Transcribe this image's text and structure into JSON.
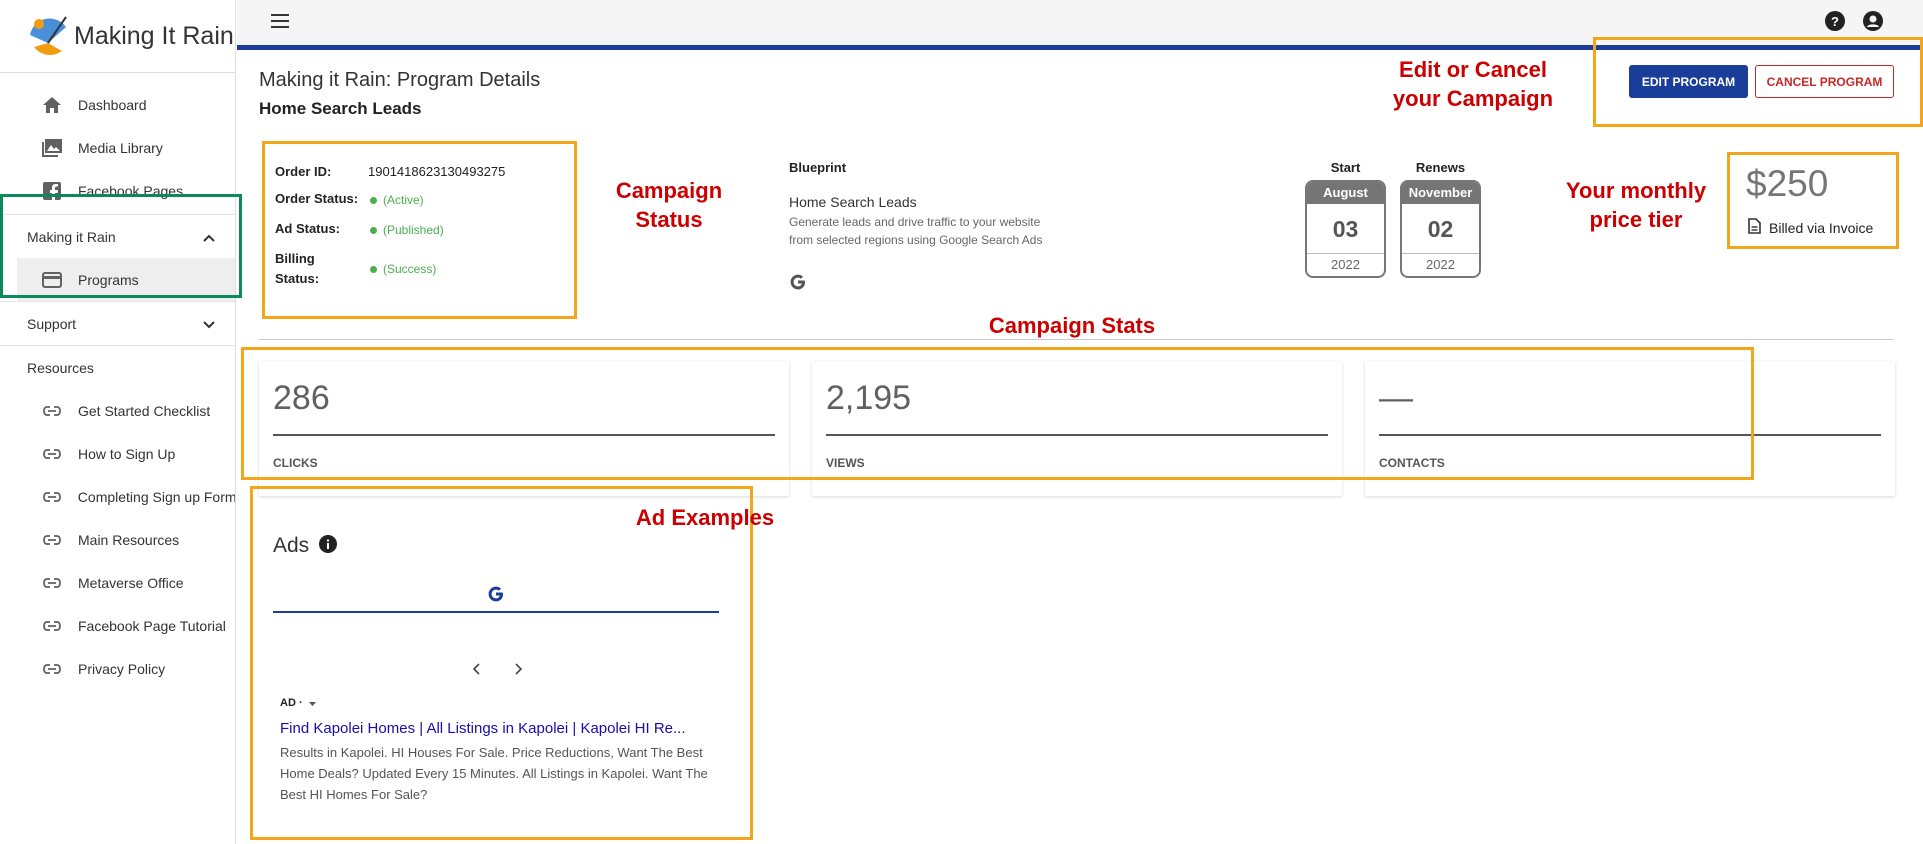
{
  "app": {
    "name": "Making It Rain"
  },
  "sidebar": {
    "items": [
      {
        "label": "Dashboard",
        "icon": "home-icon"
      },
      {
        "label": "Media Library",
        "icon": "image-icon"
      },
      {
        "label": "Facebook Pages",
        "icon": "facebook-icon"
      }
    ],
    "group_making": {
      "label": "Making it Rain",
      "child": "Programs"
    },
    "group_support": {
      "label": "Support"
    },
    "resources_label": "Resources",
    "resources": [
      "Get Started Checklist",
      "How to Sign Up",
      "Completing Sign up Form",
      "Main Resources",
      "Metaverse Office",
      "Facebook Page Tutorial",
      "Privacy Policy"
    ]
  },
  "page": {
    "title": "Making it Rain: Program Details",
    "subtitle": "Home Search Leads",
    "edit_label": "EDIT PROGRAM",
    "cancel_label": "CANCEL PROGRAM"
  },
  "order": {
    "id_label": "Order ID:",
    "id_value": "1901418623130493275",
    "status_label": "Order Status:",
    "status_value": "(Active)",
    "ad_label": "Ad Status:",
    "ad_value": "(Published)",
    "billing_label": "Billing Status:",
    "billing_value": "(Success)"
  },
  "blueprint": {
    "label": "Blueprint",
    "name": "Home Search Leads",
    "description": "Generate leads and drive traffic to your website from selected regions using Google Search Ads"
  },
  "dates": {
    "start_label": "Start",
    "start_month": "August",
    "start_day": "03",
    "start_year": "2022",
    "renew_label": "Renews",
    "renew_month": "November",
    "renew_day": "02",
    "renew_year": "2022"
  },
  "price": {
    "amount": "$250",
    "billing": "Billed via Invoice"
  },
  "stats": [
    {
      "value": "286",
      "label": "CLICKS"
    },
    {
      "value": "2,195",
      "label": "VIEWS"
    },
    {
      "value": "—",
      "label": "CONTACTS"
    }
  ],
  "ads": {
    "title": "Ads",
    "ad_tag": "AD ·",
    "headline": "Find Kapolei Homes | All Listings in Kapolei | Kapolei HI Re...",
    "body": "Results in Kapolei. HI Houses For Sale. Price Reductions, Want The Best Home Deals? Updated Every 15 Minutes. All Listings in Kapolei. Want The Best HI Homes For Sale?"
  },
  "annotations": {
    "edit": "Edit or Cancel your Campaign",
    "status": "Campaign Status",
    "price": "Your monthly price tier",
    "stats": "Campaign Stats",
    "ads": "Ad Examples"
  },
  "colors": {
    "primary": "#1a3d9a",
    "annotation": "#cc0000",
    "highlight": "#f2a71b",
    "success": "#4caf50"
  }
}
